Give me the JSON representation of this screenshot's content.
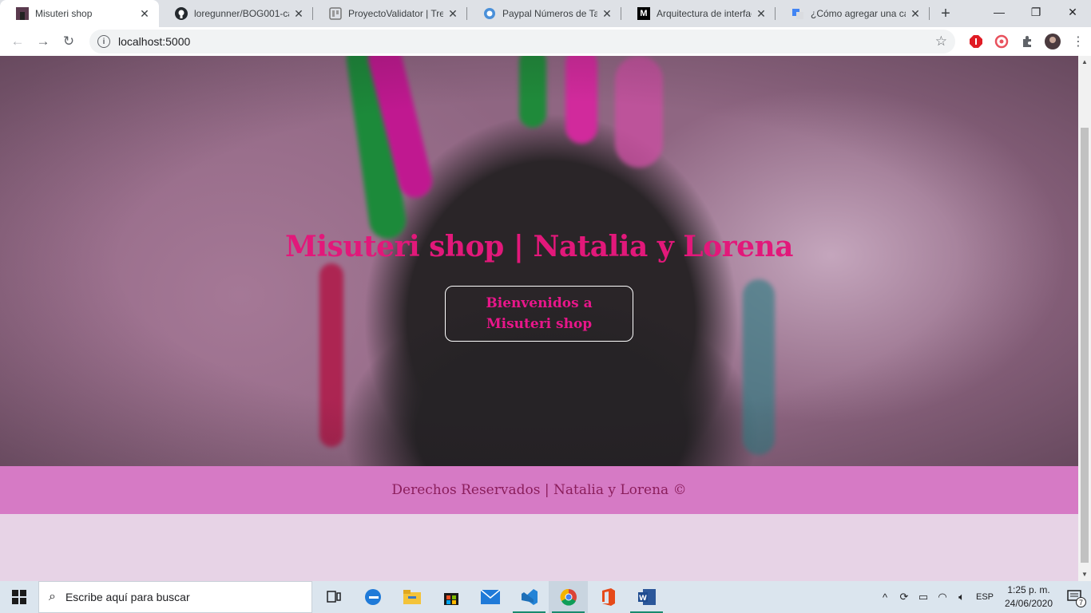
{
  "browser": {
    "tabs": [
      {
        "title": "Misuteri shop",
        "favicon": "misuteri-favicon",
        "active": true
      },
      {
        "title": "loregunner/BOG001-ca",
        "favicon": "github-icon",
        "active": false
      },
      {
        "title": "ProyectoValidator | Trell",
        "favicon": "trello-icon",
        "active": false
      },
      {
        "title": "Paypal Números de Tarj",
        "favicon": "paypal-icon",
        "active": false
      },
      {
        "title": "Arquitectura de interfac",
        "favicon": "medium-icon",
        "active": false
      },
      {
        "title": "¿Cómo agregar una cap",
        "favicon": "translate-icon",
        "active": false
      }
    ],
    "new_tab_label": "+",
    "url": "localhost:5000"
  },
  "page": {
    "hero_title": "Misuteri shop | Natalia y Lorena",
    "hero_button": "Bienvenidos a Misuteri shop",
    "footer_text": "Derechos Reservados | Natalia y Lorena ©"
  },
  "taskbar": {
    "search_placeholder": "Escribe aquí para buscar",
    "apps": [
      "task-view-icon",
      "edge-icon",
      "file-explorer-icon",
      "store-icon",
      "mail-icon",
      "vscode-icon",
      "chrome-icon",
      "office-icon",
      "word-icon"
    ],
    "language": "ESP",
    "time": "1:25 p. m.",
    "date": "24/06/2020",
    "notification_count": "7"
  },
  "colors": {
    "title_pink": "#e2187a",
    "footer_bg": "#d67ac5",
    "footer_text": "#8b1e5c"
  }
}
